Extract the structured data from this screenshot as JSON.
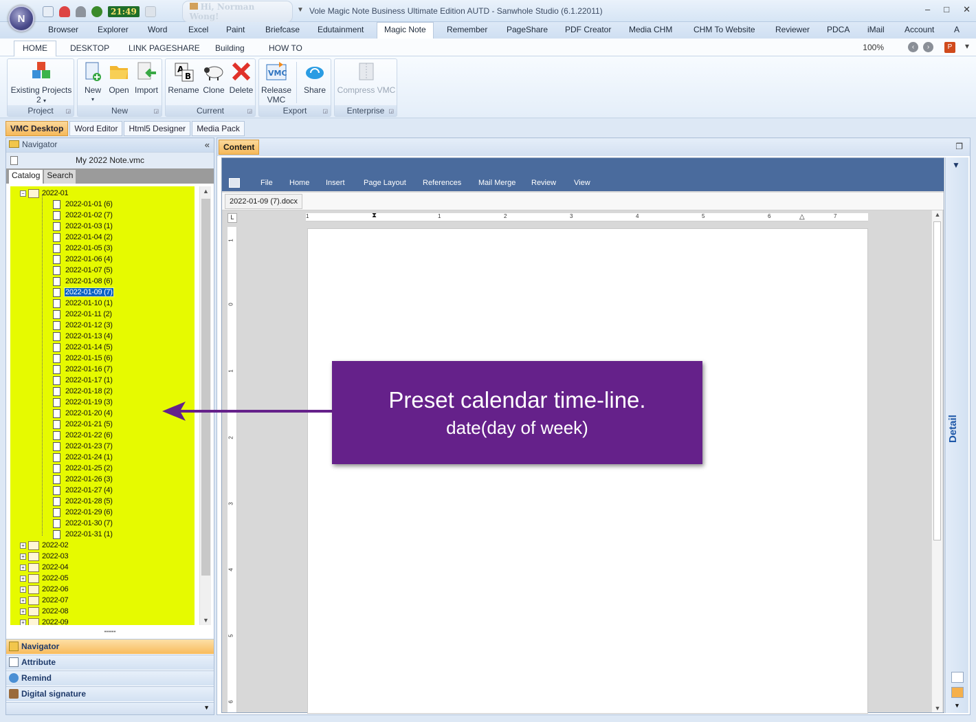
{
  "window": {
    "title": "Vole Magic Note Business Ultimate Edition AUTD - Sanwhole Studio (6.1.22011)",
    "app_orb_letter": "N",
    "clock": "21:49",
    "greeting": "Hi, Norman Wong!",
    "controls": [
      "–",
      "□",
      "✕"
    ]
  },
  "menu_tabs": [
    "Browser",
    "Explorer",
    "Word",
    "Excel",
    "Paint",
    "Briefcase",
    "Edutainment",
    "Magic Note",
    "Remember",
    "PageShare",
    "PDF Creator",
    "Media CHM",
    "CHM To Website",
    "Reviewer",
    "PDCA",
    "iMail",
    "Account",
    "A"
  ],
  "menu_active": "Magic Note",
  "ribbon": {
    "tabs": [
      "HOME",
      "DESKTOP",
      "LINK PAGESHARE",
      "Building",
      "HOW TO"
    ],
    "active_tab": "HOME",
    "zoom": "100%",
    "groups": {
      "project": {
        "label": "Project",
        "existing_projects": "Existing Projects",
        "existing_count": "2"
      },
      "new": {
        "label": "New",
        "new": "New",
        "open": "Open",
        "import": "Import"
      },
      "current": {
        "label": "Current",
        "rename": "Rename",
        "clone": "Clone",
        "delete": "Delete"
      },
      "export": {
        "label": "Export",
        "release_vmc_1": "Release",
        "release_vmc_2": "VMC",
        "share": "Share"
      },
      "enterprise": {
        "label": "Enterprise",
        "compress_vmc": "Compress VMC"
      }
    }
  },
  "doc_tabs": [
    "VMC Desktop",
    "Word Editor",
    "Html5 Designer",
    "Media Pack"
  ],
  "doc_tab_active": "VMC Desktop",
  "navigator": {
    "header": "Navigator",
    "file_name": "My 2022 Note.vmc",
    "subtabs": [
      "Catalog",
      "Search"
    ],
    "subtab_active": "Catalog",
    "tree": {
      "expanded_month": "2022-01",
      "days": [
        "2022-01-01 (6)",
        "2022-01-02 (7)",
        "2022-01-03 (1)",
        "2022-01-04 (2)",
        "2022-01-05 (3)",
        "2022-01-06 (4)",
        "2022-01-07 (5)",
        "2022-01-08 (6)",
        "2022-01-09 (7)",
        "2022-01-10 (1)",
        "2022-01-11 (2)",
        "2022-01-12 (3)",
        "2022-01-13 (4)",
        "2022-01-14 (5)",
        "2022-01-15 (6)",
        "2022-01-16 (7)",
        "2022-01-17 (1)",
        "2022-01-18 (2)",
        "2022-01-19 (3)",
        "2022-01-20 (4)",
        "2022-01-21 (5)",
        "2022-01-22 (6)",
        "2022-01-23 (7)",
        "2022-01-24 (1)",
        "2022-01-25 (2)",
        "2022-01-26 (3)",
        "2022-01-27 (4)",
        "2022-01-28 (5)",
        "2022-01-29 (6)",
        "2022-01-30 (7)",
        "2022-01-31 (1)"
      ],
      "selected_day": "2022-01-09 (7)",
      "collapsed_months": [
        "2022-02",
        "2022-03",
        "2022-04",
        "2022-05",
        "2022-06",
        "2022-07",
        "2022-08",
        "2022-09"
      ]
    },
    "bottom_panels": [
      "Navigator",
      "Attribute",
      "Remind",
      "Digital signature"
    ],
    "bottom_active": "Navigator"
  },
  "content": {
    "tab": "Content",
    "word_menu": [
      "File",
      "Home",
      "Insert",
      "Page Layout",
      "References",
      "Mail Merge",
      "Review",
      "View"
    ],
    "document_tab": "2022-01-09 (7).docx",
    "ruler_numbers": [
      "1",
      "1",
      "2",
      "3",
      "4",
      "5",
      "6",
      "7"
    ],
    "vruler_numbers": [
      "1",
      "0",
      "1",
      "2",
      "3",
      "4",
      "5",
      "6"
    ],
    "detail_label": "Detail"
  },
  "callout": {
    "line1": "Preset calendar time-line.",
    "line2": "date(day of week)",
    "color": "#65218a"
  },
  "colors": {
    "tree_background": "#e6fa00",
    "selection": "#0b62c4",
    "active_tab_orange": "#f6b95a",
    "word_menubar": "#4a6b9d"
  }
}
